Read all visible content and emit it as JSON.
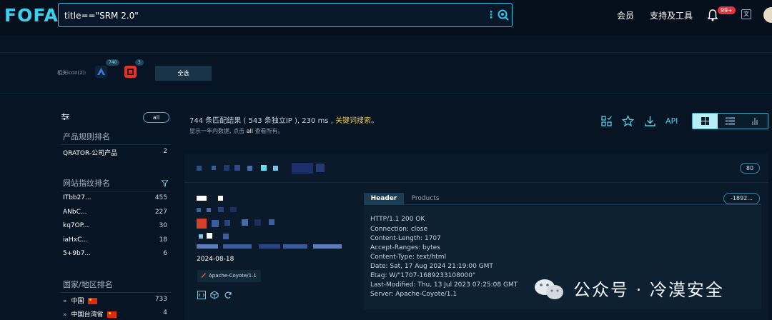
{
  "app": {
    "logo": "FOFA"
  },
  "search": {
    "query": "title==\"SRM 2.0\""
  },
  "nav": {
    "member": "会员",
    "support": "支持及工具",
    "notification_badge": "99+"
  },
  "related": {
    "label": "相关icon(2):",
    "icons": [
      {
        "count": "740",
        "color": "#3b7de0"
      },
      {
        "count": "3",
        "color": "#e0342b"
      }
    ],
    "select_all": "全选"
  },
  "sidebar": {
    "all_pill": "all",
    "product_title": "产品规则排名",
    "products": [
      {
        "label": "QRATOR-公司产品",
        "count": "2"
      }
    ],
    "fingerprint_title": "网站指纹排名",
    "fingerprints": [
      {
        "label": "ITbb27...",
        "count": "455"
      },
      {
        "label": "ANbC...",
        "count": "227"
      },
      {
        "label": "kq7OP...",
        "count": "30"
      },
      {
        "label": "iaHxC...",
        "count": "18"
      },
      {
        "label": "5+9b7...",
        "count": "6"
      }
    ],
    "country_title": "国家/地区排名",
    "countries": [
      {
        "label": "中国",
        "count": "733"
      },
      {
        "label": "中国台湾省",
        "count": "4"
      }
    ]
  },
  "results": {
    "count": "744",
    "text_a": "条匹配结果 (",
    "unique_ip": "543",
    "text_b": "条独立IP ),",
    "ms": "230",
    "text_c": "ms ,",
    "keyword_link": "关键词搜索",
    "period": "。",
    "sub_a": "显示一年内数据, 点击",
    "sub_all": "all",
    "sub_b": "查看所有。",
    "api": "API"
  },
  "card": {
    "port": "80",
    "date": "2024-08-18",
    "server_tag": "Apache-Coyote/1.1",
    "tab_header": "Header",
    "tab_products": "Products",
    "version_pill": "-1892...",
    "header_lines": [
      "HTTP/1.1 200 OK",
      "Connection: close",
      "Content-Length: 1707",
      "Accept-Ranges: bytes",
      "Content-Type: text/html",
      "Date: Sat, 17 Aug 2024 21:19:00 GMT",
      "Etag: W/\"1707-1689233108000\"",
      "Last-Modified: Thu, 13 Jul 2023 07:25:08 GMT",
      "Server: Apache-Coyote/1.1"
    ]
  },
  "watermark": {
    "text": "公众号 · 冷漠安全"
  }
}
